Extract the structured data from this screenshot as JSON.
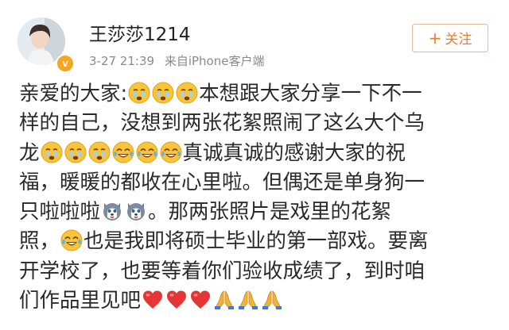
{
  "post": {
    "username": "王莎莎1214",
    "time": "3-27 21:39",
    "source": "来自iPhone客户端",
    "follow_label": "关注",
    "lines": [
      [
        {
          "t": "text",
          "v": "亲爱的大家:"
        },
        {
          "t": "emoji",
          "icon": "crying-face-icon"
        },
        {
          "t": "emoji",
          "icon": "crying-face-icon"
        },
        {
          "t": "emoji",
          "icon": "crying-face-icon"
        },
        {
          "t": "text",
          "v": "本想跟大家分享一下不一"
        }
      ],
      [
        {
          "t": "text",
          "v": "样的自己，没想到两张花絮照闹了这么大个乌"
        }
      ],
      [
        {
          "t": "text",
          "v": "龙"
        },
        {
          "t": "emoji",
          "icon": "crying-face-icon"
        },
        {
          "t": "emoji",
          "icon": "crying-face-icon"
        },
        {
          "t": "emoji",
          "icon": "crying-face-icon"
        },
        {
          "t": "emoji",
          "icon": "tears-of-joy-icon"
        },
        {
          "t": "emoji",
          "icon": "tears-of-joy-icon"
        },
        {
          "t": "emoji",
          "icon": "tears-of-joy-icon"
        },
        {
          "t": "text",
          "v": "真诚真诚的感谢大家的祝"
        }
      ],
      [
        {
          "t": "text",
          "v": "福，暖暖的都收在心里啦。但偶还是单身狗一"
        }
      ],
      [
        {
          "t": "text",
          "v": "只啦啦啦"
        },
        {
          "t": "emoji",
          "icon": "husky-dog-icon"
        },
        {
          "t": "emoji",
          "icon": "husky-dog-icon"
        },
        {
          "t": "text",
          "v": "。那两张照片是戏里的花絮"
        }
      ],
      [
        {
          "t": "text",
          "v": "照，"
        },
        {
          "t": "emoji",
          "icon": "tears-of-joy-icon"
        },
        {
          "t": "text",
          "v": "也是我即将硕士毕业的第一部戏。要离"
        }
      ],
      [
        {
          "t": "text",
          "v": "开学校了，也要等着你们验收成绩了，到时咱"
        }
      ],
      [
        {
          "t": "text",
          "v": "们作品里见吧"
        },
        {
          "t": "emoji",
          "icon": "red-heart-icon"
        },
        {
          "t": "emoji",
          "icon": "red-heart-icon"
        },
        {
          "t": "emoji",
          "icon": "red-heart-icon"
        },
        {
          "t": "emoji",
          "icon": "folded-hands-icon"
        },
        {
          "t": "emoji",
          "icon": "folded-hands-icon"
        },
        {
          "t": "emoji",
          "icon": "folded-hands-icon"
        }
      ]
    ]
  },
  "colors": {
    "accent": "#f07a2b",
    "verified": "#f6a623",
    "meta_text": "#8a8a8a",
    "body_text": "#2a2a2a"
  }
}
